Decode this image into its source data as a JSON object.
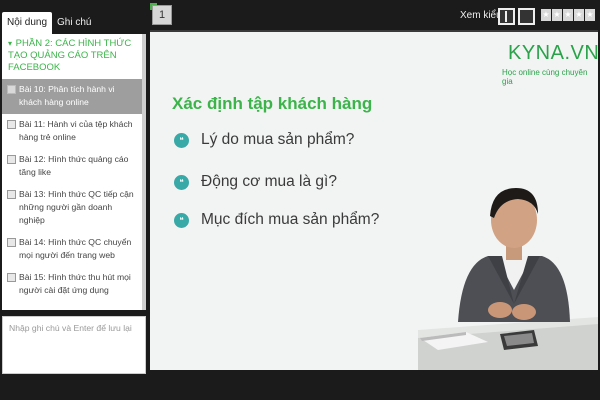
{
  "tabs": [
    {
      "label": "Nội dung",
      "active": true
    },
    {
      "label": "Ghi chú",
      "active": false
    }
  ],
  "section": {
    "caret": "▾",
    "title": "PHẦN 2: CÁC HÌNH THỨC TẠO QUẢNG CÁO TRÊN FACEBOOK"
  },
  "lessons": [
    {
      "label": "Bài 10: Phân tích hành vi khách hàng online",
      "active": true
    },
    {
      "label": "Bài 11: Hành vi của tệp khách hàng trẻ online",
      "active": false
    },
    {
      "label": "Bài 12: Hình thức quảng cáo tăng like",
      "active": false
    },
    {
      "label": "Bài 13: Hình thức QC tiếp cận những người gần doanh nghiệp",
      "active": false
    },
    {
      "label": "Bài 14: Hình thức QC chuyển mọi người đến trang web",
      "active": false
    },
    {
      "label": "Bài 15: Hình thức thu hút mọi người cài đặt ứng dụng",
      "active": false
    }
  ],
  "note": {
    "placeholder": "Nhập ghi chú và Enter để lưu lại"
  },
  "topbar": {
    "page_number": "1",
    "view_label": "Xem kiểu",
    "rating": 0,
    "max_rating": 5
  },
  "slide": {
    "logo": "KYNA.VN",
    "logo_tagline": "Học online cùng chuyên gia",
    "title": "Xác định tập khách hàng",
    "bullets": [
      "Lý do mua sản phẩm?",
      "Động cơ mua là gì?",
      "Mục đích mua sản phẩm?"
    ]
  },
  "colors": {
    "accent": "#3bb44a",
    "bullet_icon": "#39a9a8",
    "active_lesson": "#9e9e9e"
  },
  "icons": {
    "section_caret": "caret-down-icon",
    "bullet": "chat-bubble-icon",
    "star": "star-icon"
  }
}
